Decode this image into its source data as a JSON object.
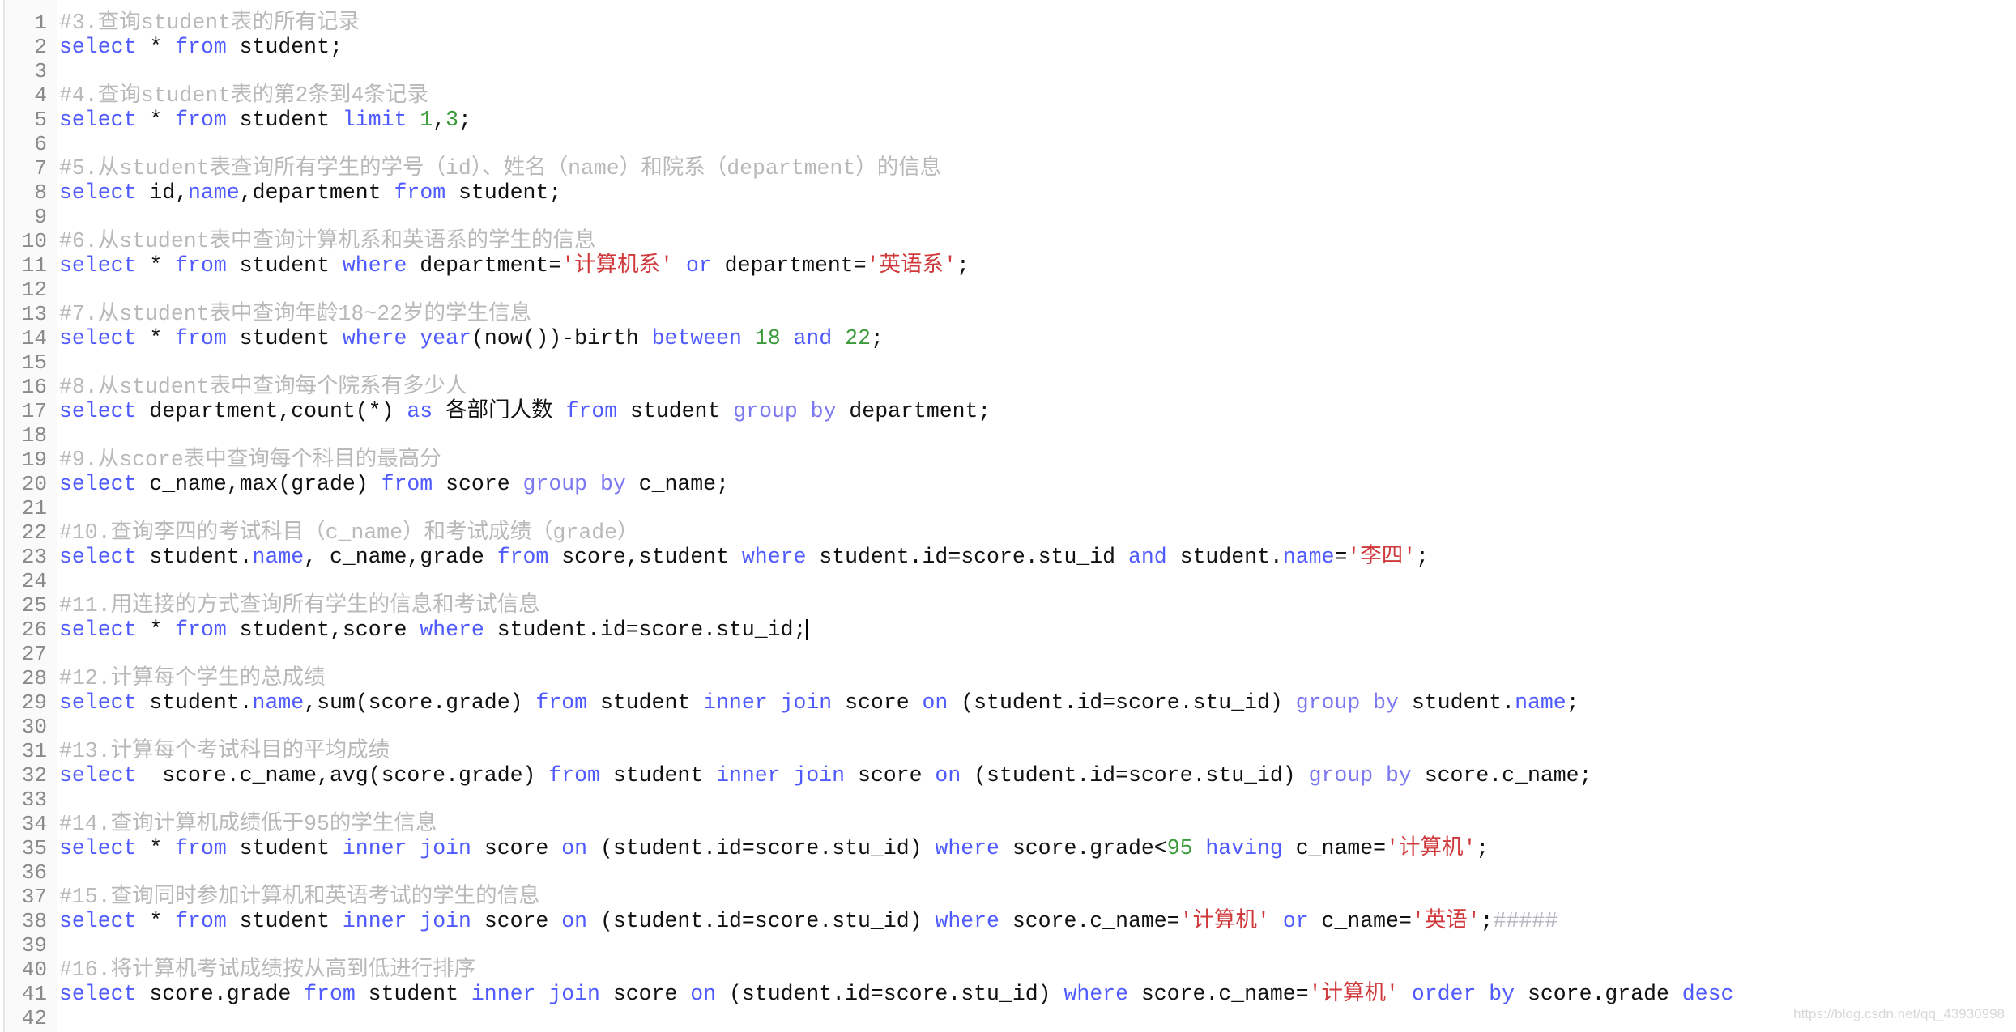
{
  "editor": {
    "colors": {
      "keyword": "#4f5bff",
      "comment": "#b9b9b9",
      "string": "#d0393b",
      "number": "#3b9b3b",
      "text": "#111111",
      "line_number": "#8a8a8a"
    },
    "cursor_line": 26,
    "lines": [
      [
        [
          "c",
          "#3.查询student表的所有记录"
        ]
      ],
      [
        [
          "k",
          "select"
        ],
        [
          "p",
          " * "
        ],
        [
          "k",
          "from"
        ],
        [
          "p",
          " student;"
        ]
      ],
      [],
      [
        [
          "c",
          "#4.查询student表的第2条到4条记录"
        ]
      ],
      [
        [
          "k",
          "select"
        ],
        [
          "p",
          " * "
        ],
        [
          "k",
          "from"
        ],
        [
          "p",
          " student "
        ],
        [
          "k",
          "limit"
        ],
        [
          "p",
          " "
        ],
        [
          "n",
          "1"
        ],
        [
          "p",
          ","
        ],
        [
          "n",
          "3"
        ],
        [
          "p",
          ";"
        ]
      ],
      [],
      [
        [
          "c",
          "#5.从student表查询所有学生的学号（id）、姓名（name）和院系（department）的信息"
        ]
      ],
      [
        [
          "k",
          "select"
        ],
        [
          "p",
          " id,"
        ],
        [
          "k",
          "name"
        ],
        [
          "p",
          ",department "
        ],
        [
          "k",
          "from"
        ],
        [
          "p",
          " student;"
        ]
      ],
      [],
      [
        [
          "c",
          "#6.从student表中查询计算机系和英语系的学生的信息"
        ]
      ],
      [
        [
          "k",
          "select"
        ],
        [
          "p",
          " * "
        ],
        [
          "k",
          "from"
        ],
        [
          "p",
          " student "
        ],
        [
          "k",
          "where"
        ],
        [
          "p",
          " department="
        ],
        [
          "s",
          "'计算机系'"
        ],
        [
          "p",
          " "
        ],
        [
          "k",
          "or"
        ],
        [
          "p",
          " department="
        ],
        [
          "s",
          "'英语系'"
        ],
        [
          "p",
          ";"
        ]
      ],
      [],
      [
        [
          "c",
          "#7.从student表中查询年龄18~22岁的学生信息"
        ]
      ],
      [
        [
          "k",
          "select"
        ],
        [
          "p",
          " * "
        ],
        [
          "k",
          "from"
        ],
        [
          "p",
          " student "
        ],
        [
          "k",
          "where"
        ],
        [
          "p",
          " "
        ],
        [
          "k",
          "year"
        ],
        [
          "p",
          "(now())-birth "
        ],
        [
          "k",
          "between"
        ],
        [
          "p",
          " "
        ],
        [
          "n",
          "18"
        ],
        [
          "p",
          " "
        ],
        [
          "k",
          "and"
        ],
        [
          "p",
          " "
        ],
        [
          "n",
          "22"
        ],
        [
          "p",
          ";"
        ]
      ],
      [],
      [
        [
          "c",
          "#8.从student表中查询每个院系有多少人"
        ]
      ],
      [
        [
          "k",
          "select"
        ],
        [
          "p",
          " department,count(*) "
        ],
        [
          "k",
          "as"
        ],
        [
          "p",
          " 各部门人数 "
        ],
        [
          "k",
          "from"
        ],
        [
          "p",
          " student "
        ],
        [
          "g",
          "group by"
        ],
        [
          "p",
          " department;"
        ]
      ],
      [],
      [
        [
          "c",
          "#9.从score表中查询每个科目的最高分"
        ]
      ],
      [
        [
          "k",
          "select"
        ],
        [
          "p",
          " c_name,max(grade) "
        ],
        [
          "k",
          "from"
        ],
        [
          "p",
          " score "
        ],
        [
          "g",
          "group by"
        ],
        [
          "p",
          " c_name;"
        ]
      ],
      [],
      [
        [
          "c",
          "#10.查询李四的考试科目（c_name）和考试成绩（grade）"
        ]
      ],
      [
        [
          "k",
          "select"
        ],
        [
          "p",
          " student."
        ],
        [
          "k",
          "name"
        ],
        [
          "p",
          ", c_name,grade "
        ],
        [
          "k",
          "from"
        ],
        [
          "p",
          " score,student "
        ],
        [
          "k",
          "where"
        ],
        [
          "p",
          " student.id=score.stu_id "
        ],
        [
          "k",
          "and"
        ],
        [
          "p",
          " student."
        ],
        [
          "k",
          "name"
        ],
        [
          "p",
          "="
        ],
        [
          "s",
          "'李四'"
        ],
        [
          "p",
          ";"
        ]
      ],
      [],
      [
        [
          "c",
          "#11.用连接的方式查询所有学生的信息和考试信息"
        ]
      ],
      [
        [
          "k",
          "select"
        ],
        [
          "p",
          " * "
        ],
        [
          "k",
          "from"
        ],
        [
          "p",
          " student,score "
        ],
        [
          "k",
          "where"
        ],
        [
          "p",
          " student.id=score.stu_id;"
        ]
      ],
      [],
      [
        [
          "c",
          "#12.计算每个学生的总成绩"
        ]
      ],
      [
        [
          "k",
          "select"
        ],
        [
          "p",
          " student."
        ],
        [
          "k",
          "name"
        ],
        [
          "p",
          ",sum(score.grade) "
        ],
        [
          "k",
          "from"
        ],
        [
          "p",
          " student "
        ],
        [
          "k",
          "inner join"
        ],
        [
          "p",
          " score "
        ],
        [
          "k",
          "on"
        ],
        [
          "p",
          " (student.id=score.stu_id) "
        ],
        [
          "g",
          "group by"
        ],
        [
          "p",
          " student."
        ],
        [
          "k",
          "name"
        ],
        [
          "p",
          ";"
        ]
      ],
      [],
      [
        [
          "c",
          "#13.计算每个考试科目的平均成绩"
        ]
      ],
      [
        [
          "k",
          "select"
        ],
        [
          "p",
          "  score.c_name,avg(score.grade) "
        ],
        [
          "k",
          "from"
        ],
        [
          "p",
          " student "
        ],
        [
          "k",
          "inner join"
        ],
        [
          "p",
          " score "
        ],
        [
          "k",
          "on"
        ],
        [
          "p",
          " (student.id=score.stu_id) "
        ],
        [
          "g",
          "group by"
        ],
        [
          "p",
          " score.c_name;"
        ]
      ],
      [],
      [
        [
          "c",
          "#14.查询计算机成绩低于95的学生信息"
        ]
      ],
      [
        [
          "k",
          "select"
        ],
        [
          "p",
          " * "
        ],
        [
          "k",
          "from"
        ],
        [
          "p",
          " student "
        ],
        [
          "k",
          "inner join"
        ],
        [
          "p",
          " score "
        ],
        [
          "k",
          "on"
        ],
        [
          "p",
          " (student.id=score.stu_id) "
        ],
        [
          "k",
          "where"
        ],
        [
          "p",
          " score.grade<"
        ],
        [
          "n",
          "95"
        ],
        [
          "p",
          " "
        ],
        [
          "k",
          "having"
        ],
        [
          "p",
          " c_name="
        ],
        [
          "s",
          "'计算机'"
        ],
        [
          "p",
          ";"
        ]
      ],
      [],
      [
        [
          "c",
          "#15.查询同时参加计算机和英语考试的学生的信息"
        ]
      ],
      [
        [
          "k",
          "select"
        ],
        [
          "p",
          " * "
        ],
        [
          "k",
          "from"
        ],
        [
          "p",
          " student "
        ],
        [
          "k",
          "inner join"
        ],
        [
          "p",
          " score "
        ],
        [
          "k",
          "on"
        ],
        [
          "p",
          " (student.id=score.stu_id) "
        ],
        [
          "k",
          "where"
        ],
        [
          "p",
          " score.c_name="
        ],
        [
          "s",
          "'计算机'"
        ],
        [
          "p",
          " "
        ],
        [
          "k",
          "or"
        ],
        [
          "p",
          " c_name="
        ],
        [
          "s",
          "'英语'"
        ],
        [
          "p",
          ";"
        ],
        [
          "h",
          "#####"
        ]
      ],
      [],
      [
        [
          "c",
          "#16.将计算机考试成绩按从高到低进行排序"
        ]
      ],
      [
        [
          "k",
          "select"
        ],
        [
          "p",
          " score.grade "
        ],
        [
          "k",
          "from"
        ],
        [
          "p",
          " student "
        ],
        [
          "k",
          "inner join"
        ],
        [
          "p",
          " score "
        ],
        [
          "k",
          "on"
        ],
        [
          "p",
          " (student.id=score.stu_id) "
        ],
        [
          "k",
          "where"
        ],
        [
          "p",
          " score.c_name="
        ],
        [
          "s",
          "'计算机'"
        ],
        [
          "p",
          " "
        ],
        [
          "k",
          "order by"
        ],
        [
          "p",
          " score.grade "
        ],
        [
          "k",
          "desc"
        ]
      ],
      []
    ]
  },
  "watermark": "https://blog.csdn.net/qq_43930998"
}
